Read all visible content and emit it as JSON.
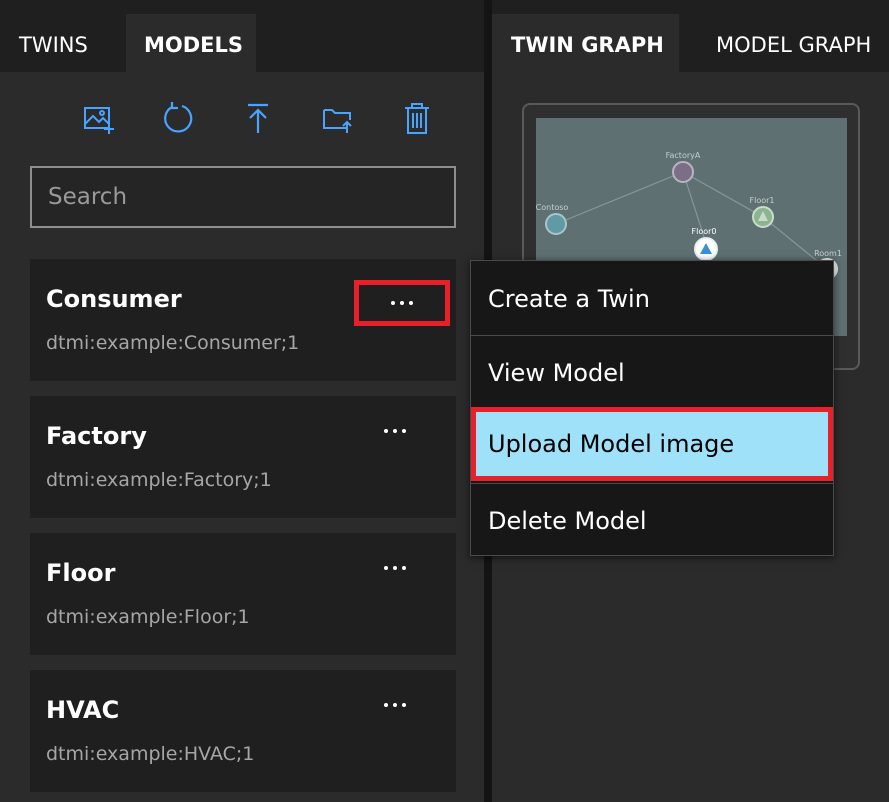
{
  "left_tabs": [
    {
      "label": "TWINS",
      "selected": false
    },
    {
      "label": "MODELS",
      "selected": true
    }
  ],
  "toolbar": {
    "icons": [
      "upload-model-image-icon",
      "refresh-icon",
      "upload-icon",
      "import-folder-icon",
      "delete-icon"
    ],
    "accent_color": "#4aa3ff"
  },
  "search": {
    "placeholder": "Search",
    "value": ""
  },
  "models": [
    {
      "name": "Consumer",
      "id": "dtmi:example:Consumer;1",
      "more_label": "···"
    },
    {
      "name": "Factory",
      "id": "dtmi:example:Factory;1",
      "more_label": "···"
    },
    {
      "name": "Floor",
      "id": "dtmi:example:Floor;1",
      "more_label": "···"
    },
    {
      "name": "HVAC",
      "id": "dtmi:example:HVAC;1",
      "more_label": "···"
    }
  ],
  "right_tabs": [
    {
      "label": "TWIN GRAPH",
      "selected": true
    },
    {
      "label": "MODEL GRAPH",
      "selected": false
    }
  ],
  "preview": {
    "nodes": [
      "FactoryA",
      "Contoso",
      "Floor1",
      "Floor0",
      "Room1"
    ]
  },
  "context_menu": {
    "items": [
      {
        "label": "Create a Twin"
      },
      {
        "label": "View Model"
      },
      {
        "label": "Upload Model image",
        "highlighted": true
      },
      {
        "label": "Delete Model"
      }
    ]
  },
  "colors": {
    "highlight_border": "#e8202a",
    "active_menu_bg": "#9ee1f9"
  }
}
